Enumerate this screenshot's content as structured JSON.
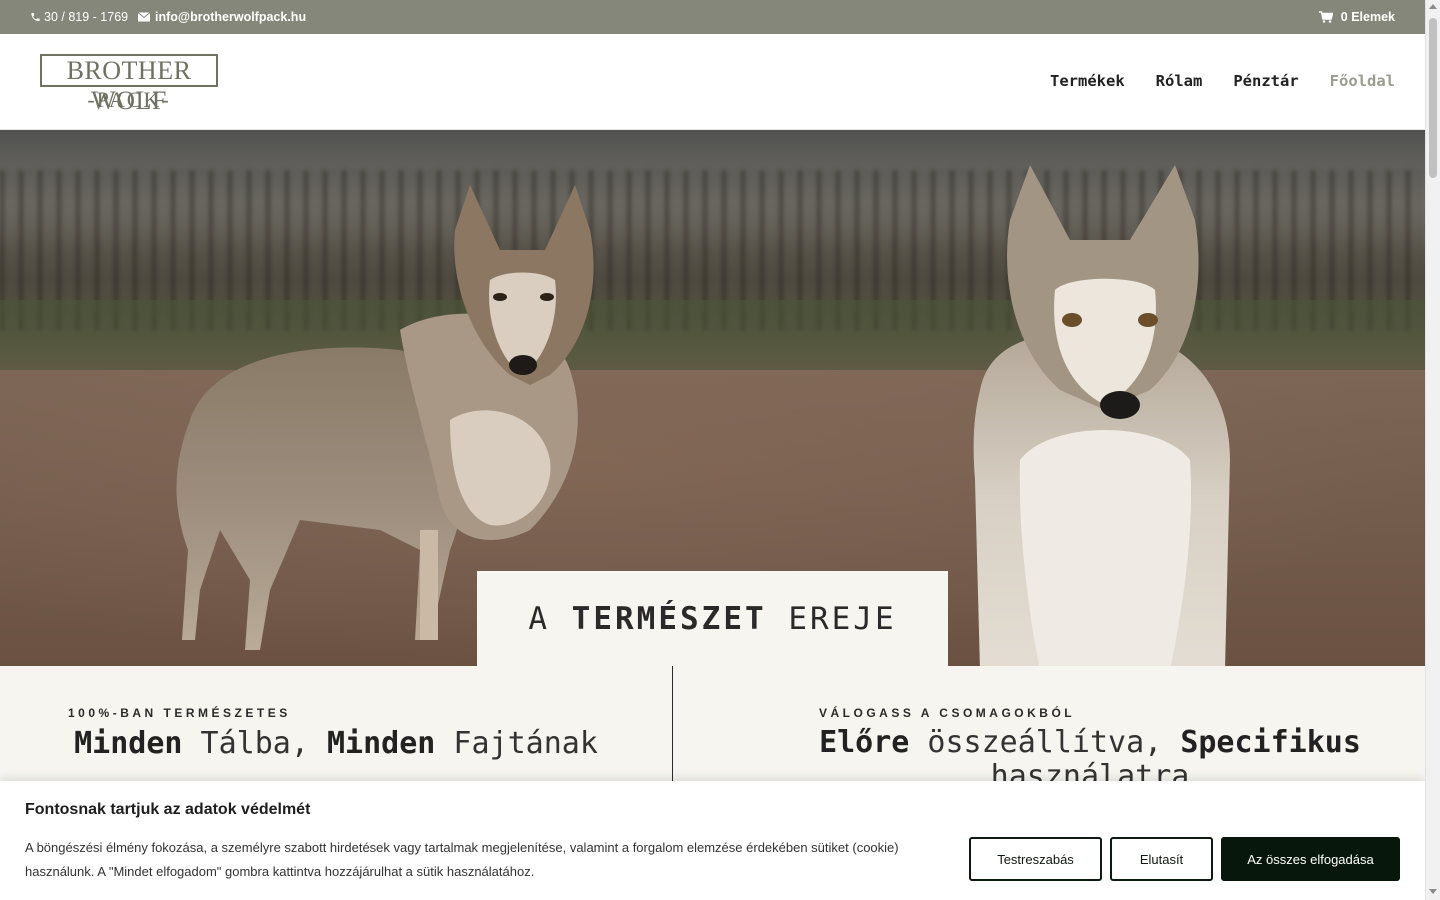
{
  "topbar": {
    "phone": "30 / 819 - 1769",
    "email": "info@brotherwolfpack.hu",
    "cart": "0 Elemek"
  },
  "header": {
    "logo_line1": "BROTHER WOLF",
    "logo_line2": "-PACK-",
    "nav": [
      "Termékek",
      "Rólam",
      "Pénztár",
      "Főoldal"
    ]
  },
  "hero": {
    "title_pre": "A ",
    "title_bold": "TERMÉSZET",
    "title_post": " EREJE"
  },
  "sections": {
    "left": {
      "eyebrow": "100%-BAN TERMÉSZETES",
      "h1_bold": "Minden",
      "h1_a": " Tálba, ",
      "h1_bold2": "Minden",
      "h1_b": " Fajtának"
    },
    "right": {
      "eyebrow": "VÁLOGASS A CSOMAGOKBÓL",
      "h1_bold": "Előre",
      "h1_a": " összeállítva, ",
      "h1_bold2": "Specifikus",
      "h1_b": " használatra"
    }
  },
  "cookie": {
    "title": "Fontosnak tartjuk az adatok védelmét",
    "text": "A böngészési élmény fokozása, a személyre szabott hirdetések vagy tartalmak megjelenítése, valamint a forgalom elemzése érdekében sütiket (cookie) használunk. A \"Mindet elfogadom\" gombra kattintva hozzájárulhat a sütik használatához.",
    "btn_customize": "Testreszabás",
    "btn_reject": "Elutasít",
    "btn_accept": "Az összes elfogadása"
  }
}
